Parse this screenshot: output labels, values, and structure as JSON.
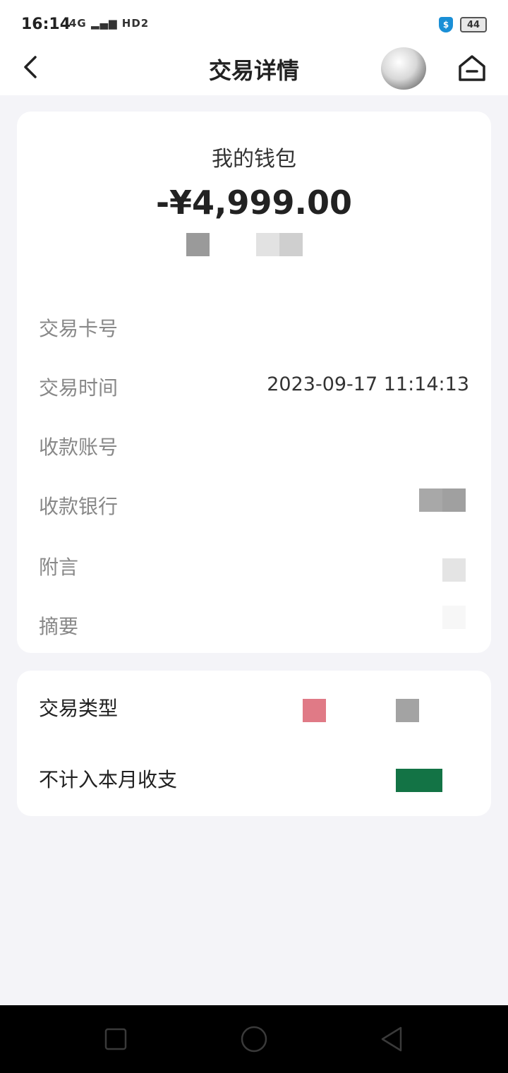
{
  "status_bar": {
    "time": "16:14",
    "network_indicators": "4G ▂▄▆ HD2",
    "shield_glyph": "$",
    "battery_level": "44"
  },
  "header": {
    "title": "交易详情"
  },
  "transaction": {
    "account_name": "我的钱包",
    "amount": "-¥4,999.00",
    "rows": [
      {
        "label": "交易卡号",
        "value": ""
      },
      {
        "label": "交易时间",
        "value": "2023-09-17 11:14:13"
      },
      {
        "label": "收款账号",
        "value": ""
      },
      {
        "label": "收款银行",
        "value": ""
      },
      {
        "label": "附言",
        "value": ""
      },
      {
        "label": "摘要",
        "value": ""
      }
    ]
  },
  "extra": {
    "rows": [
      {
        "label": "交易类型"
      },
      {
        "label": "不计入本月收支"
      }
    ]
  },
  "colors": {
    "page_background": "#f4f4f8",
    "card_background": "#ffffff",
    "label_gray": "#888888",
    "type_tag_pink": "#e07a86",
    "toggle_green": "#137345",
    "shield_blue": "#1a8fd6"
  },
  "icons": {
    "back": "chevron-left-icon",
    "home": "home-icon",
    "nav_recent": "square-icon",
    "nav_home": "circle-icon",
    "nav_back": "triangle-left-icon"
  }
}
